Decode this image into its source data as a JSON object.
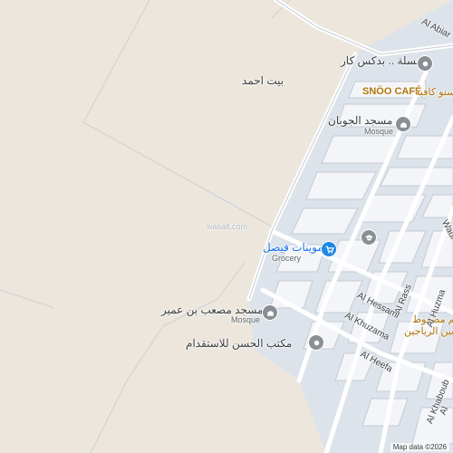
{
  "map": {
    "colors": {
      "land": "#ece6dc",
      "block": "#eef1f5",
      "road": "#ffffff",
      "road_edge": "#c5cbd3",
      "path": "#bcc7d2"
    },
    "places": [
      {
        "id": "beit",
        "name": "بيت احمد"
      },
      {
        "id": "wash",
        "name": "مغسلة .. بدكس كار",
        "icon": "pin-icon"
      },
      {
        "id": "cafe",
        "name": "SNÖO CAFÉ",
        "name_ar": "سنو كافيه"
      },
      {
        "id": "mosque1",
        "name": "مسجد الجوبان",
        "sub": "Mosque",
        "icon": "mosque-icon"
      },
      {
        "id": "grocery",
        "name": "تموينات فيصل",
        "sub": "Grocery",
        "icon": "cart-icon"
      },
      {
        "id": "mosque2",
        "name": "مسجد مصعب بن عمير",
        "sub": "Mosque",
        "icon": "mosque-icon"
      },
      {
        "id": "office",
        "name": "مكتب الحسن للاستقدام",
        "icon": "pin-icon"
      },
      {
        "id": "rest",
        "name": "مطعم مضغوط",
        "name2": "أبو بين الرياجين"
      },
      {
        "id": "school",
        "icon": "school-icon"
      }
    ],
    "watermark": "wasalt.com",
    "streets": [
      "Al Abiar",
      "Wadi",
      "Al Rass",
      "Al Huzma",
      "Al Hessami",
      "Al Khuzama",
      "Al Heefa",
      "Al Khaboub",
      "Al"
    ],
    "attribution": "Map data ©2026"
  }
}
